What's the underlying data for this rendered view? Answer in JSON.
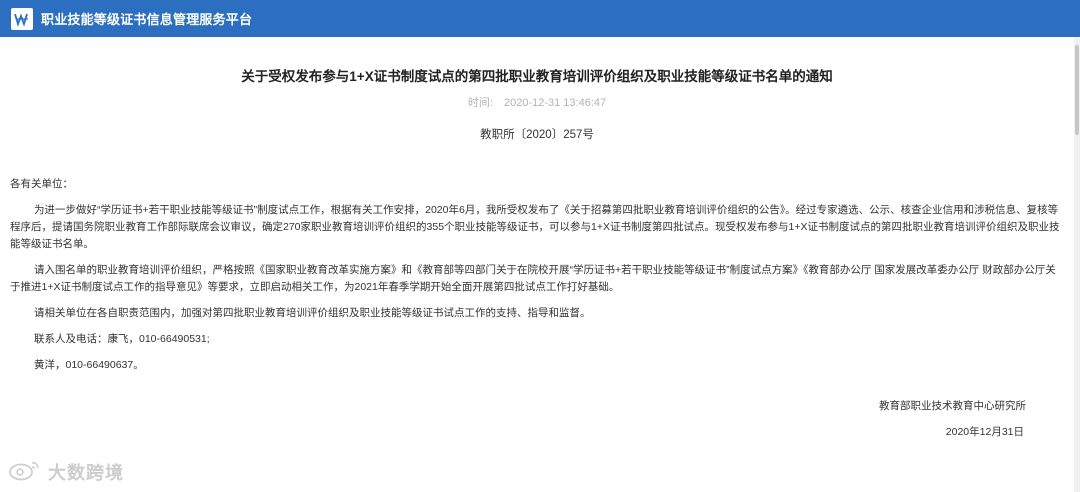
{
  "header": {
    "logo_icon": "platform-logo-icon",
    "brand_name": "职业技能等级证书信息管理服务平台",
    "background": "#2c6fc0"
  },
  "article": {
    "title": "关于受权发布参与1+X证书制度试点的第四批职业教育培训评价组织及职业技能等级证书名单的通知",
    "time_label": "时间:",
    "time_value": "2020-12-31 13:46:47",
    "doc_number": "教职所〔2020〕257号",
    "salutation": "各有关单位：",
    "paragraphs": [
      "为进一步做好“学历证书+若干职业技能等级证书”制度试点工作，根据有关工作安排，2020年6月，我所受权发布了《关于招募第四批职业教育培训评价组织的公告》。经过专家遴选、公示、核查企业信用和涉税信息、复核等程序后，提请国务院职业教育工作部际联席会议审议，确定270家职业教育培训评价组织的355个职业技能等级证书，可以参与1+X证书制度第四批试点。现受权发布参与1+X证书制度试点的第四批职业教育培训评价组织及职业技能等级证书名单。",
      "请入围名单的职业教育培训评价组织，严格按照《国家职业教育改革实施方案》和《教育部等四部门关于在院校开展“学历证书+若干职业技能等级证书”制度试点方案》《教育部办公厅 国家发展改革委办公厅 财政部办公厅关于推进1+X证书制度试点工作的指导意见》等要求，立即启动相关工作，为2021年春季学期开始全面开展第四批试点工作打好基础。",
      "请相关单位在各自职责范围内，加强对第四批职业教育培训评价组织及职业技能等级证书试点工作的支持、指导和监督。"
    ],
    "contact_line1": "联系人及电话：康飞，010-66490531;",
    "contact_line2": "黄洋，010-66490637。",
    "signature": "教育部职业技术教育中心研究所",
    "date": "2020年12月31日"
  },
  "watermark": {
    "icon": "weibo-logo-icon",
    "text": "大数跨境"
  }
}
